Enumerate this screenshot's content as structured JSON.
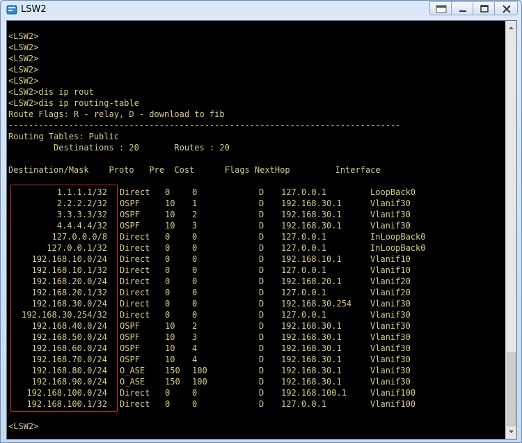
{
  "window": {
    "title": "LSW2",
    "icon": "terminal-app-icon",
    "controls": [
      "restore-icon",
      "minimize-icon",
      "maximize-icon",
      "close-icon"
    ]
  },
  "terminal": {
    "lines": [
      "<LSW2>",
      "<LSW2>",
      "<LSW2>",
      "<LSW2>",
      "<LSW2>",
      "<LSW2>dis ip rout",
      "<LSW2>dis ip routing-table",
      "Route Flags: R - relay, D - download to fib",
      "------------------------------------------------------------------------------",
      "Routing Tables: Public",
      "         Destinations : 20       Routes : 20",
      "",
      "Destination/Mask    Proto   Pre  Cost      Flags NextHop         Interface"
    ],
    "rows": [
      {
        "dest": "1.1.1.1/32",
        "proto": "Direct",
        "pre": "0",
        "cost": "0",
        "flags": "D",
        "nexthop": "127.0.0.1",
        "iface": "LoopBack0"
      },
      {
        "dest": "2.2.2.2/32",
        "proto": "OSPF",
        "pre": "10",
        "cost": "1",
        "flags": "D",
        "nexthop": "192.168.30.1",
        "iface": "Vlanif30"
      },
      {
        "dest": "3.3.3.3/32",
        "proto": "OSPF",
        "pre": "10",
        "cost": "2",
        "flags": "D",
        "nexthop": "192.168.30.1",
        "iface": "Vlanif30"
      },
      {
        "dest": "4.4.4.4/32",
        "proto": "OSPF",
        "pre": "10",
        "cost": "3",
        "flags": "D",
        "nexthop": "192.168.30.1",
        "iface": "Vlanif30"
      },
      {
        "dest": "127.0.0.0/8",
        "proto": "Direct",
        "pre": "0",
        "cost": "0",
        "flags": "D",
        "nexthop": "127.0.0.1",
        "iface": "InLoopBack0"
      },
      {
        "dest": "127.0.0.1/32",
        "proto": "Direct",
        "pre": "0",
        "cost": "0",
        "flags": "D",
        "nexthop": "127.0.0.1",
        "iface": "InLoopBack0"
      },
      {
        "dest": "192.168.10.0/24",
        "proto": "Direct",
        "pre": "0",
        "cost": "0",
        "flags": "D",
        "nexthop": "192.168.10.1",
        "iface": "Vlanif10"
      },
      {
        "dest": "192.168.10.1/32",
        "proto": "Direct",
        "pre": "0",
        "cost": "0",
        "flags": "D",
        "nexthop": "127.0.0.1",
        "iface": "Vlanif10"
      },
      {
        "dest": "192.168.20.0/24",
        "proto": "Direct",
        "pre": "0",
        "cost": "0",
        "flags": "D",
        "nexthop": "192.168.20.1",
        "iface": "Vlanif20"
      },
      {
        "dest": "192.168.20.1/32",
        "proto": "Direct",
        "pre": "0",
        "cost": "0",
        "flags": "D",
        "nexthop": "127.0.0.1",
        "iface": "Vlanif20"
      },
      {
        "dest": "192.168.30.0/24",
        "proto": "Direct",
        "pre": "0",
        "cost": "0",
        "flags": "D",
        "nexthop": "192.168.30.254",
        "iface": "Vlanif30"
      },
      {
        "dest": "192.168.30.254/32",
        "proto": "Direct",
        "pre": "0",
        "cost": "0",
        "flags": "D",
        "nexthop": "127.0.0.1",
        "iface": "Vlanif30"
      },
      {
        "dest": "192.168.40.0/24",
        "proto": "OSPF",
        "pre": "10",
        "cost": "2",
        "flags": "D",
        "nexthop": "192.168.30.1",
        "iface": "Vlanif30"
      },
      {
        "dest": "192.168.50.0/24",
        "proto": "OSPF",
        "pre": "10",
        "cost": "3",
        "flags": "D",
        "nexthop": "192.168.30.1",
        "iface": "Vlanif30"
      },
      {
        "dest": "192.168.60.0/24",
        "proto": "OSPF",
        "pre": "10",
        "cost": "4",
        "flags": "D",
        "nexthop": "192.168.30.1",
        "iface": "Vlanif30"
      },
      {
        "dest": "192.168.70.0/24",
        "proto": "OSPF",
        "pre": "10",
        "cost": "4",
        "flags": "D",
        "nexthop": "192.168.30.1",
        "iface": "Vlanif30"
      },
      {
        "dest": "192.168.80.0/24",
        "proto": "O_ASE",
        "pre": "150",
        "cost": "100",
        "flags": "D",
        "nexthop": "192.168.30.1",
        "iface": "Vlanif30"
      },
      {
        "dest": "192.168.90.0/24",
        "proto": "O_ASE",
        "pre": "150",
        "cost": "100",
        "flags": "D",
        "nexthop": "192.168.30.1",
        "iface": "Vlanif30"
      },
      {
        "dest": "192.168.100.0/24",
        "proto": "Direct",
        "pre": "0",
        "cost": "0",
        "flags": "D",
        "nexthop": "192.168.100.1",
        "iface": "Vlanif100"
      },
      {
        "dest": "192.168.100.1/32",
        "proto": "Direct",
        "pre": "0",
        "cost": "0",
        "flags": "D",
        "nexthop": "127.0.0.1",
        "iface": "Vlanif100"
      }
    ],
    "prompt": "<LSW2>",
    "text_color": "#d8cc88",
    "highlight_color": "#d42a2a"
  }
}
